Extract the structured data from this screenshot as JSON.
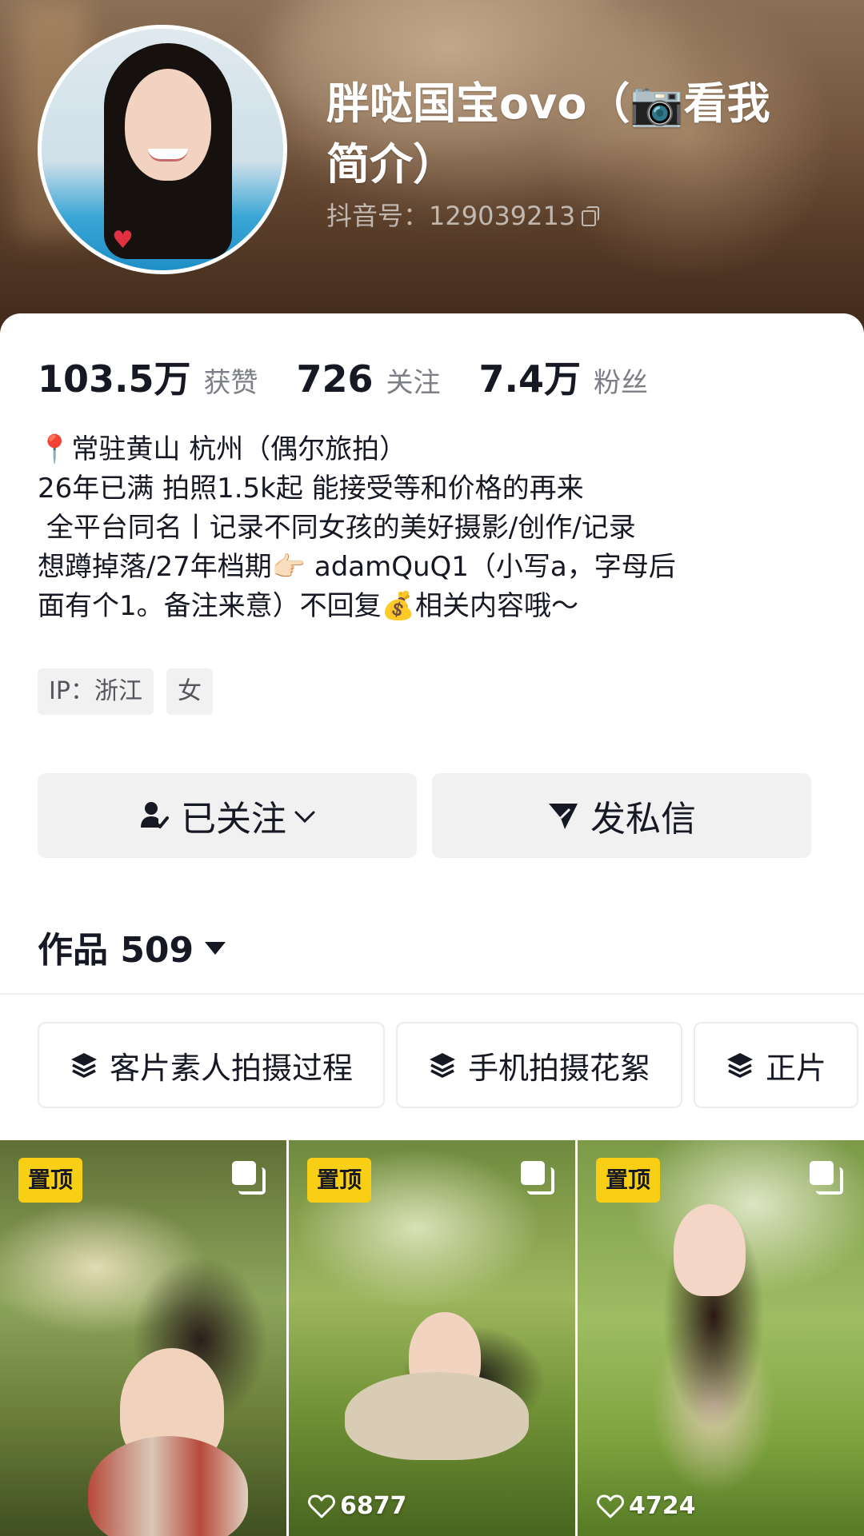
{
  "profile": {
    "nickname": "胖哒国宝ovo（📷看我简介）",
    "douyin_id_label": "抖音号：129039213"
  },
  "stats": [
    {
      "value": "103.5万",
      "label": "获赞"
    },
    {
      "value": "726",
      "label": "关注"
    },
    {
      "value": "7.4万",
      "label": "粉丝"
    }
  ],
  "bio": [
    "📍常驻黄山 杭州（偶尔旅拍）",
    "26年已满 拍照1.5k起 能接受等和价格的再来",
    " 全平台同名丨记录不同女孩的美好摄影/创作/记录",
    "想蹲掉落/27年档期👉🏻 adamQuQ1（小写a，字母后",
    "面有个1。备注来意）不回复💰相关内容哦～"
  ],
  "tags": [
    "IP：浙江",
    "女"
  ],
  "actions": {
    "follow_label": "已关注",
    "message_label": "发私信"
  },
  "works": {
    "title": "作品 509"
  },
  "collections": [
    "客片素人拍摄过程",
    "手机拍摄花絮",
    "正片"
  ],
  "videos": [
    {
      "pinned_label": "置顶",
      "likes": ""
    },
    {
      "pinned_label": "置顶",
      "likes": "6877"
    },
    {
      "pinned_label": "置顶",
      "likes": "4724"
    }
  ],
  "colors": {
    "pin_badge": "#f9cf16",
    "text_primary": "#161823",
    "text_secondary": "#7d7f86",
    "button_bg": "#f1f1f2"
  },
  "icons": [
    "copy-icon",
    "person-check-icon",
    "chevron-down-icon",
    "send-icon",
    "layers-icon",
    "heart-outline-icon",
    "multi-image-icon",
    "triangle-down-icon"
  ]
}
